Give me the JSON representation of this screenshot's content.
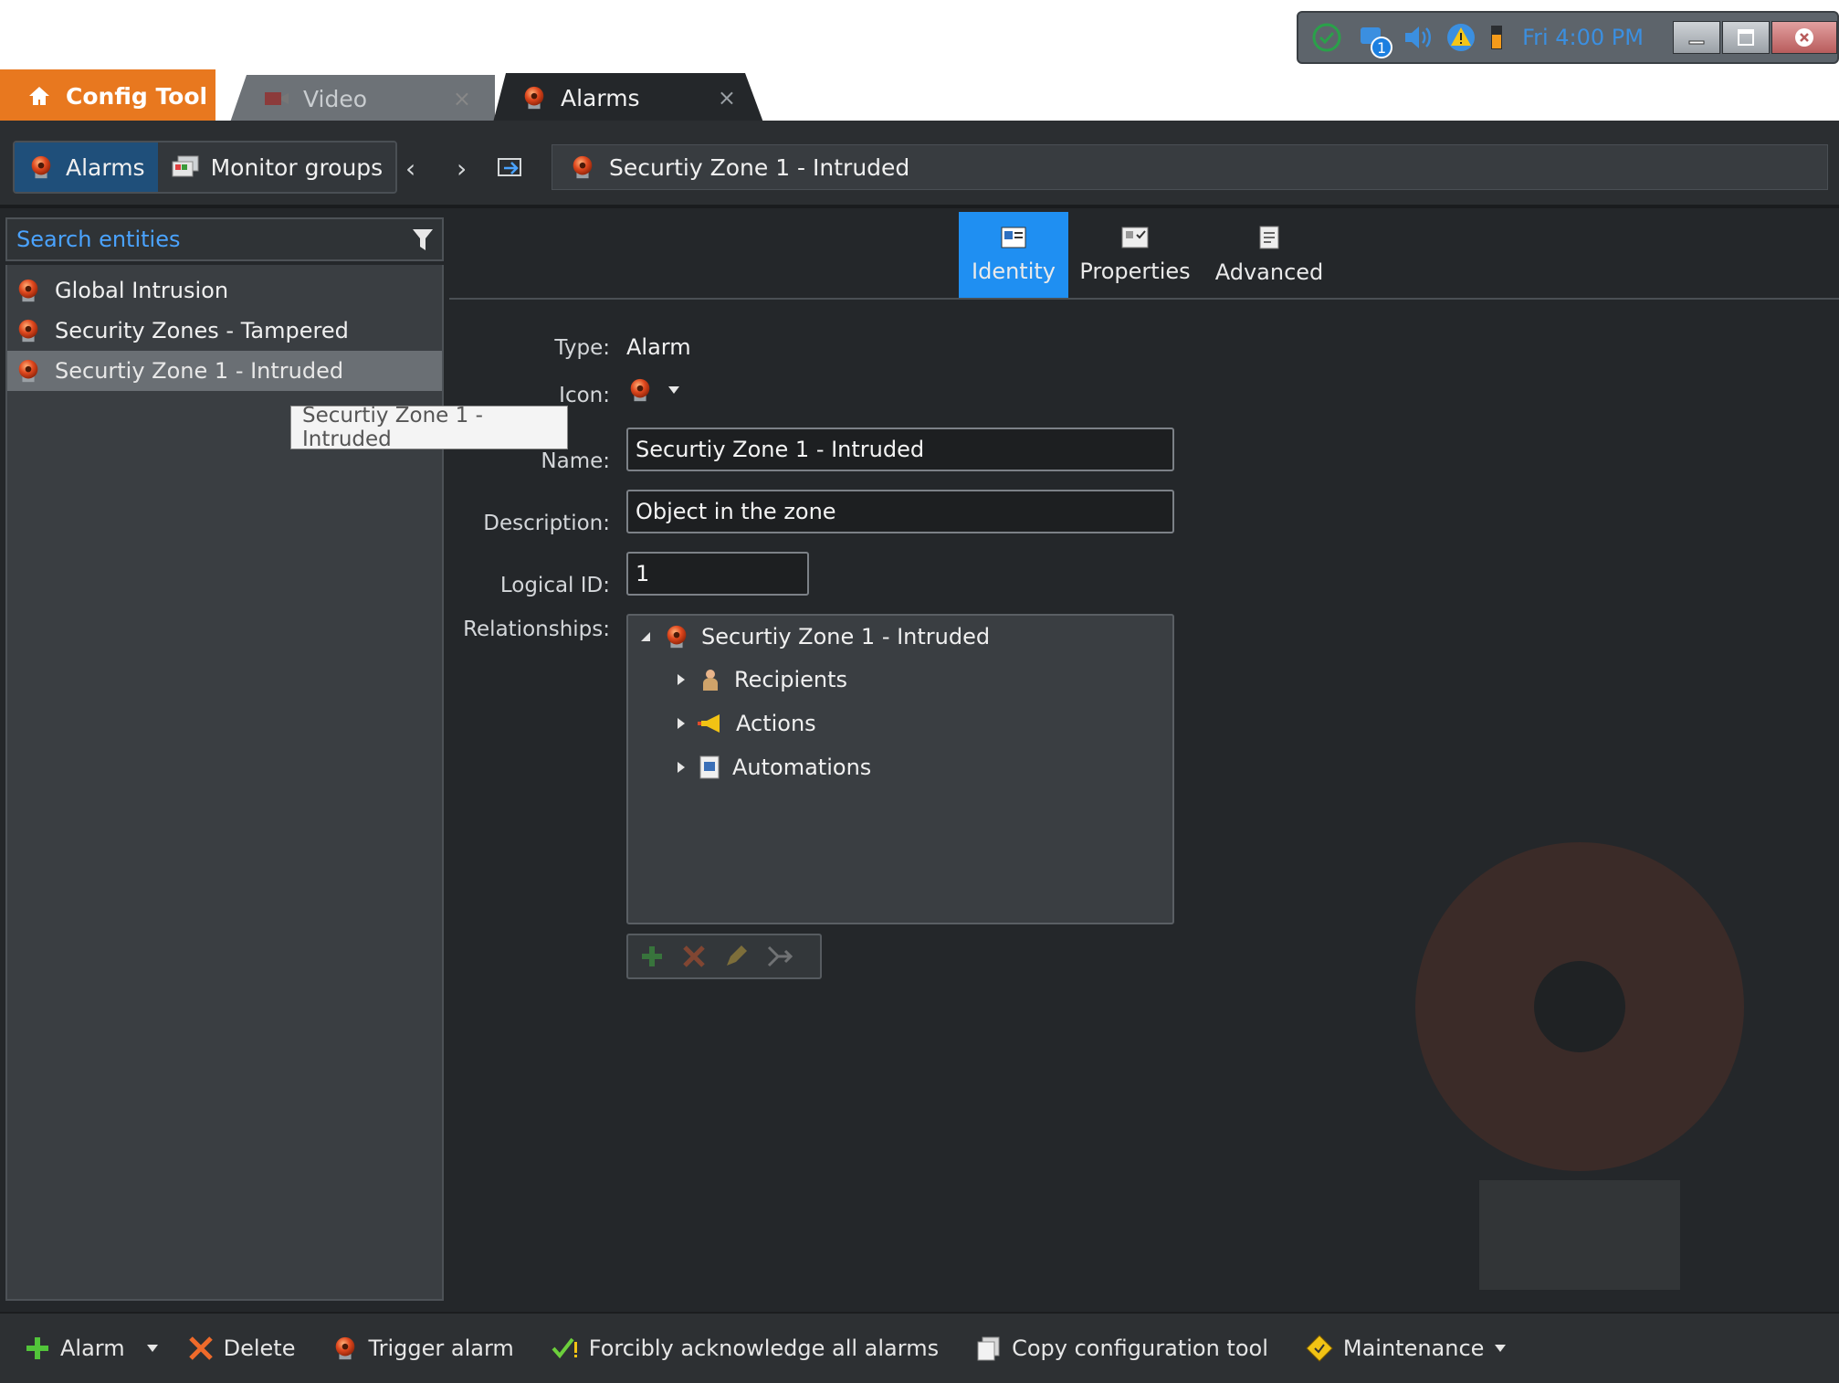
{
  "tray": {
    "network_badge": "1",
    "clock": "Fri 4:00 PM"
  },
  "tabs": {
    "config_tool": "Config Tool",
    "video": "Video",
    "alarms": "Alarms",
    "close_glyph": "×"
  },
  "toolbar": {
    "alarms_label": "Alarms",
    "monitor_groups_label": "Monitor groups",
    "back_glyph": "‹",
    "forward_glyph": "›",
    "path": "Securtiy Zone 1 - Intruded"
  },
  "search": {
    "placeholder": "Search entities"
  },
  "entities": [
    {
      "label": "Global Intrusion"
    },
    {
      "label": "Security Zones - Tampered"
    },
    {
      "label": "Securtiy Zone 1 - Intruded"
    }
  ],
  "tooltip": "Securtiy Zone 1 - Intruded",
  "page_tabs": {
    "identity": "Identity",
    "properties": "Properties",
    "advanced": "Advanced"
  },
  "form": {
    "type_label": "Type:",
    "type_value": "Alarm",
    "icon_label": "Icon:",
    "name_label": "Name:",
    "name_value": "Securtiy Zone 1 - Intruded",
    "description_label": "Description:",
    "description_value": "Object in the zone",
    "logical_id_label": "Logical ID:",
    "logical_id_value": "1",
    "relationships_label": "Relationships:"
  },
  "relationships": {
    "root": "Securtiy Zone 1 - Intruded",
    "children": [
      "Recipients",
      "Actions",
      "Automations"
    ]
  },
  "bottom": {
    "alarm": "Alarm",
    "delete": "Delete",
    "trigger": "Trigger alarm",
    "ack_all": "Forcibly acknowledge all alarms",
    "copy_config": "Copy configuration tool",
    "maintenance": "Maintenance"
  },
  "colors": {
    "accent_orange": "#e8781f",
    "selected_tab_blue": "#1f8ff2",
    "alarm_red": "#e0481e",
    "link_blue": "#4aa3ff"
  }
}
